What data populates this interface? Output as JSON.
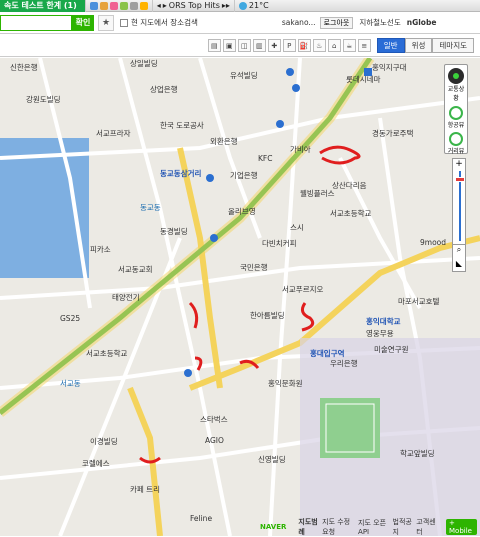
{
  "toolbar": {
    "brand": "속도 테스트 한계 (1)",
    "music": "ORS Top Hits",
    "weather": "21°C"
  },
  "search": {
    "value": "",
    "button": "확인",
    "checkbox_label": "현 지도에서 장소검색",
    "user": "sakano...",
    "logout": "로그아웃",
    "links_prefix": "지하철노선도",
    "links_brand": "nGlobe"
  },
  "view": {
    "tabs": [
      "일반",
      "위성",
      "테마지도"
    ],
    "active": "일반"
  },
  "map_controls": {
    "traffic": "교통상황",
    "hangdong": "항공뷰",
    "distance": "거리뷰"
  },
  "footer": {
    "title": "지도범례",
    "links": [
      "지도 수정요청",
      "지도 오픈API",
      "법적공지",
      "고객센터"
    ],
    "mobile": "+ Mobile",
    "naver": "NAVER"
  },
  "map": {
    "labels": [
      {
        "id": "l1",
        "text": "신한은행"
      },
      {
        "id": "l2",
        "text": "상일빌딩"
      },
      {
        "id": "l3",
        "text": "유석빌딩"
      },
      {
        "id": "l4",
        "text": "롯데시네마"
      },
      {
        "id": "l5",
        "text": "홍익지구대"
      },
      {
        "id": "l6",
        "text": "강원도빌딩"
      },
      {
        "id": "l7",
        "text": "상업은행"
      },
      {
        "id": "l8",
        "text": "서교프라자"
      },
      {
        "id": "l9",
        "text": "외환은행"
      },
      {
        "id": "l10",
        "text": "한국 도로공사"
      },
      {
        "id": "l11",
        "text": "동교동삼거리"
      },
      {
        "id": "l12",
        "text": "기업은행"
      },
      {
        "id": "l13",
        "text": "KFC"
      },
      {
        "id": "l14",
        "text": "가비아"
      },
      {
        "id": "l15",
        "text": "상산다리음"
      },
      {
        "id": "l16",
        "text": "올리브영"
      },
      {
        "id": "l17",
        "text": "스시"
      },
      {
        "id": "l18",
        "text": "서교초등학교"
      },
      {
        "id": "l19",
        "text": "동경빌딩"
      },
      {
        "id": "l20",
        "text": "서교동교회"
      },
      {
        "id": "l21",
        "text": "국민은행"
      },
      {
        "id": "l22",
        "text": "피카소"
      },
      {
        "id": "l23",
        "text": "태양전기"
      },
      {
        "id": "l24",
        "text": "서교푸르지오"
      },
      {
        "id": "l25",
        "text": "홍익대학교"
      },
      {
        "id": "l26",
        "text": "마포서교호텔"
      },
      {
        "id": "l27",
        "text": "영웅무용"
      },
      {
        "id": "l28",
        "text": "서교초등학교"
      },
      {
        "id": "l29",
        "text": "이경빌딩"
      },
      {
        "id": "l30",
        "text": "스타벅스"
      },
      {
        "id": "l31",
        "text": "AGIO"
      },
      {
        "id": "l32",
        "text": "신영빌딩"
      },
      {
        "id": "l33",
        "text": "홍익문화원"
      },
      {
        "id": "l34",
        "text": "Feline"
      },
      {
        "id": "l35",
        "text": "카페 트리"
      },
      {
        "id": "l36",
        "text": "홍대입구역"
      },
      {
        "id": "l37",
        "text": "서교동"
      },
      {
        "id": "l38",
        "text": "동교동"
      },
      {
        "id": "l39",
        "text": "코렐에스"
      },
      {
        "id": "l40",
        "text": "우리은행"
      },
      {
        "id": "l41",
        "text": "경동가로주택"
      },
      {
        "id": "l42",
        "text": "미술연구원"
      },
      {
        "id": "l43",
        "text": "학교앞빌딩"
      },
      {
        "id": "l44",
        "text": "9mood"
      },
      {
        "id": "l45",
        "text": "GS25"
      },
      {
        "id": "l46",
        "text": "한아름빌딩"
      },
      {
        "id": "l47",
        "text": "웰빙플러스"
      },
      {
        "id": "l48",
        "text": "다빈치커피"
      }
    ]
  }
}
